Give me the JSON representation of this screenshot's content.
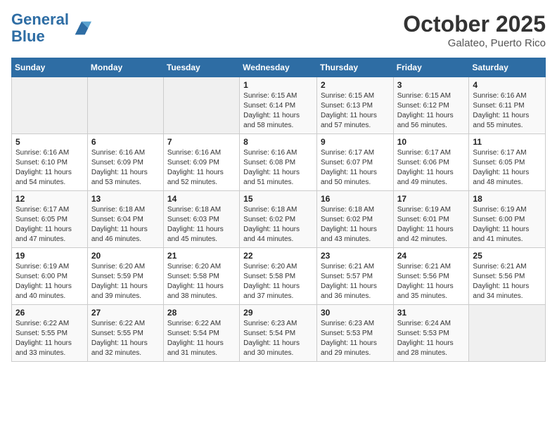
{
  "header": {
    "logo_line1": "General",
    "logo_line2": "Blue",
    "month": "October 2025",
    "location": "Galateo, Puerto Rico"
  },
  "weekdays": [
    "Sunday",
    "Monday",
    "Tuesday",
    "Wednesday",
    "Thursday",
    "Friday",
    "Saturday"
  ],
  "weeks": [
    [
      {
        "day": "",
        "info": ""
      },
      {
        "day": "",
        "info": ""
      },
      {
        "day": "",
        "info": ""
      },
      {
        "day": "1",
        "info": "Sunrise: 6:15 AM\nSunset: 6:14 PM\nDaylight: 11 hours and 58 minutes."
      },
      {
        "day": "2",
        "info": "Sunrise: 6:15 AM\nSunset: 6:13 PM\nDaylight: 11 hours and 57 minutes."
      },
      {
        "day": "3",
        "info": "Sunrise: 6:15 AM\nSunset: 6:12 PM\nDaylight: 11 hours and 56 minutes."
      },
      {
        "day": "4",
        "info": "Sunrise: 6:16 AM\nSunset: 6:11 PM\nDaylight: 11 hours and 55 minutes."
      }
    ],
    [
      {
        "day": "5",
        "info": "Sunrise: 6:16 AM\nSunset: 6:10 PM\nDaylight: 11 hours and 54 minutes."
      },
      {
        "day": "6",
        "info": "Sunrise: 6:16 AM\nSunset: 6:09 PM\nDaylight: 11 hours and 53 minutes."
      },
      {
        "day": "7",
        "info": "Sunrise: 6:16 AM\nSunset: 6:09 PM\nDaylight: 11 hours and 52 minutes."
      },
      {
        "day": "8",
        "info": "Sunrise: 6:16 AM\nSunset: 6:08 PM\nDaylight: 11 hours and 51 minutes."
      },
      {
        "day": "9",
        "info": "Sunrise: 6:17 AM\nSunset: 6:07 PM\nDaylight: 11 hours and 50 minutes."
      },
      {
        "day": "10",
        "info": "Sunrise: 6:17 AM\nSunset: 6:06 PM\nDaylight: 11 hours and 49 minutes."
      },
      {
        "day": "11",
        "info": "Sunrise: 6:17 AM\nSunset: 6:05 PM\nDaylight: 11 hours and 48 minutes."
      }
    ],
    [
      {
        "day": "12",
        "info": "Sunrise: 6:17 AM\nSunset: 6:05 PM\nDaylight: 11 hours and 47 minutes."
      },
      {
        "day": "13",
        "info": "Sunrise: 6:18 AM\nSunset: 6:04 PM\nDaylight: 11 hours and 46 minutes."
      },
      {
        "day": "14",
        "info": "Sunrise: 6:18 AM\nSunset: 6:03 PM\nDaylight: 11 hours and 45 minutes."
      },
      {
        "day": "15",
        "info": "Sunrise: 6:18 AM\nSunset: 6:02 PM\nDaylight: 11 hours and 44 minutes."
      },
      {
        "day": "16",
        "info": "Sunrise: 6:18 AM\nSunset: 6:02 PM\nDaylight: 11 hours and 43 minutes."
      },
      {
        "day": "17",
        "info": "Sunrise: 6:19 AM\nSunset: 6:01 PM\nDaylight: 11 hours and 42 minutes."
      },
      {
        "day": "18",
        "info": "Sunrise: 6:19 AM\nSunset: 6:00 PM\nDaylight: 11 hours and 41 minutes."
      }
    ],
    [
      {
        "day": "19",
        "info": "Sunrise: 6:19 AM\nSunset: 6:00 PM\nDaylight: 11 hours and 40 minutes."
      },
      {
        "day": "20",
        "info": "Sunrise: 6:20 AM\nSunset: 5:59 PM\nDaylight: 11 hours and 39 minutes."
      },
      {
        "day": "21",
        "info": "Sunrise: 6:20 AM\nSunset: 5:58 PM\nDaylight: 11 hours and 38 minutes."
      },
      {
        "day": "22",
        "info": "Sunrise: 6:20 AM\nSunset: 5:58 PM\nDaylight: 11 hours and 37 minutes."
      },
      {
        "day": "23",
        "info": "Sunrise: 6:21 AM\nSunset: 5:57 PM\nDaylight: 11 hours and 36 minutes."
      },
      {
        "day": "24",
        "info": "Sunrise: 6:21 AM\nSunset: 5:56 PM\nDaylight: 11 hours and 35 minutes."
      },
      {
        "day": "25",
        "info": "Sunrise: 6:21 AM\nSunset: 5:56 PM\nDaylight: 11 hours and 34 minutes."
      }
    ],
    [
      {
        "day": "26",
        "info": "Sunrise: 6:22 AM\nSunset: 5:55 PM\nDaylight: 11 hours and 33 minutes."
      },
      {
        "day": "27",
        "info": "Sunrise: 6:22 AM\nSunset: 5:55 PM\nDaylight: 11 hours and 32 minutes."
      },
      {
        "day": "28",
        "info": "Sunrise: 6:22 AM\nSunset: 5:54 PM\nDaylight: 11 hours and 31 minutes."
      },
      {
        "day": "29",
        "info": "Sunrise: 6:23 AM\nSunset: 5:54 PM\nDaylight: 11 hours and 30 minutes."
      },
      {
        "day": "30",
        "info": "Sunrise: 6:23 AM\nSunset: 5:53 PM\nDaylight: 11 hours and 29 minutes."
      },
      {
        "day": "31",
        "info": "Sunrise: 6:24 AM\nSunset: 5:53 PM\nDaylight: 11 hours and 28 minutes."
      },
      {
        "day": "",
        "info": ""
      }
    ]
  ]
}
